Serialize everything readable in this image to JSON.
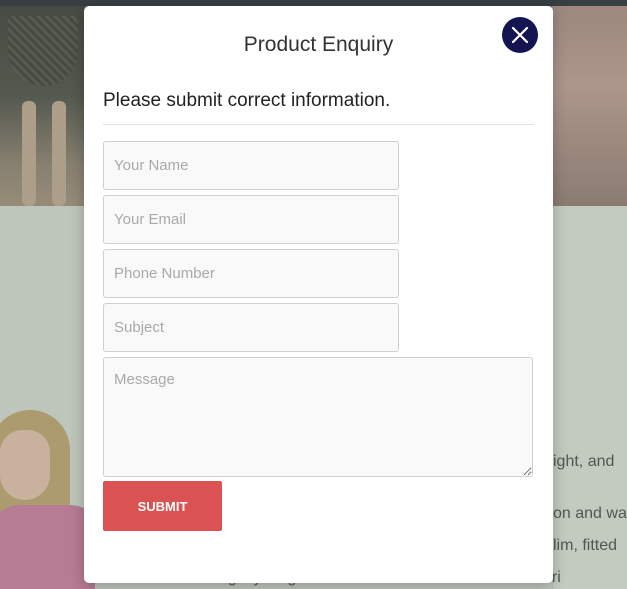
{
  "background": {
    "text_lines": [
      "ight, and",
      "on and wa",
      "lim, fitted",
      "Slightly longer front and shorter collar that won't ri"
    ]
  },
  "modal": {
    "title": "Product Enquiry",
    "subtitle": "Please submit correct information.",
    "close_icon": "close-icon",
    "fields": {
      "name": {
        "placeholder": "Your Name",
        "value": ""
      },
      "email": {
        "placeholder": "Your Email",
        "value": ""
      },
      "phone": {
        "placeholder": "Phone Number",
        "value": ""
      },
      "subject": {
        "placeholder": "Subject",
        "value": ""
      },
      "message": {
        "placeholder": "Message",
        "value": ""
      }
    },
    "submit_label": "SUBMIT"
  },
  "colors": {
    "close_button": "#141550",
    "submit_button": "#db5253",
    "input_background": "#f9f9f9"
  }
}
